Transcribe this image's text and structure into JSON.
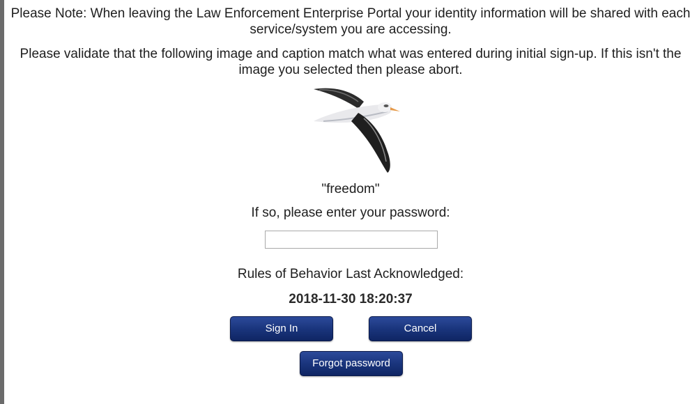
{
  "notices": {
    "identity_notice": "Please Note: When leaving the Law Enforcement Enterprise Portal your identity information will be shared with each service/system you are accessing.",
    "validate_notice": "Please validate that the following image and caption match what was entered during initial sign-up. If this isn't the image you selected then please abort."
  },
  "security_image": {
    "icon": "albatross-bird-image",
    "caption": "\"freedom\""
  },
  "password": {
    "prompt": "If so, please enter your password:",
    "value": "",
    "placeholder": ""
  },
  "rules": {
    "label": "Rules of Behavior Last Acknowledged:",
    "timestamp": "2018-11-30 18:20:37"
  },
  "buttons": {
    "sign_in": "Sign In",
    "cancel": "Cancel",
    "forgot_password": "Forgot password"
  },
  "colors": {
    "button_primary": "#1a357d",
    "button_border": "#0b1a4a",
    "left_border": "#6b6b6b"
  }
}
